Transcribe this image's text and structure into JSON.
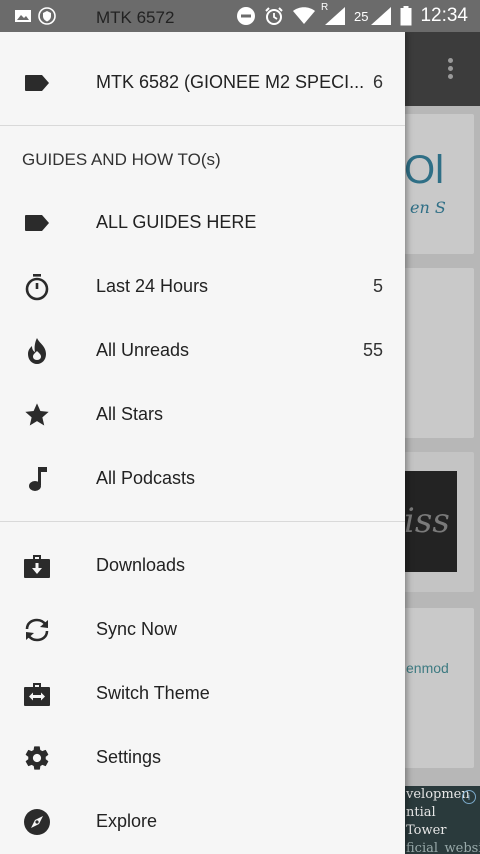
{
  "status_bar": {
    "title": "MTK 6572",
    "signal_label": "25",
    "roaming_mark": "R",
    "time": "12:34"
  },
  "drawer": {
    "top_item": {
      "label": "MTK 6582 (GIONEE M2 SPECI...",
      "count": "6",
      "icon": "label-tag-icon"
    },
    "section_title": "GUIDES AND HOW TO(s)",
    "items": [
      {
        "label": "ALL GUIDES HERE",
        "count": "",
        "icon": "label-tag-icon"
      },
      {
        "label": "Last 24 Hours",
        "count": "5",
        "icon": "timer-icon"
      },
      {
        "label": "All Unreads",
        "count": "55",
        "icon": "flame-icon"
      },
      {
        "label": "All Stars",
        "count": "",
        "icon": "star-icon"
      },
      {
        "label": "All Podcasts",
        "count": "",
        "icon": "music-note-icon"
      }
    ],
    "actions": [
      {
        "label": "Downloads",
        "icon": "download-briefcase-icon"
      },
      {
        "label": "Sync Now",
        "icon": "sync-icon"
      },
      {
        "label": "Switch Theme",
        "icon": "switch-theme-icon"
      },
      {
        "label": "Settings",
        "icon": "gear-icon"
      },
      {
        "label": "Explore",
        "icon": "compass-icon"
      }
    ]
  },
  "background": {
    "ad_lines": [
      "velopmen",
      "ntial Tower",
      "ficial_website"
    ],
    "card_text": "enmod",
    "logo_text": "Ol",
    "logo_sub": "en S",
    "dark_text": "iss",
    "ad_info": "i"
  },
  "colors": {
    "drawer_bg": "#f6f6f6",
    "status_bar": "#6b6b6b",
    "toolbar": "#3c3c3c",
    "icon": "#2b2b2b"
  }
}
